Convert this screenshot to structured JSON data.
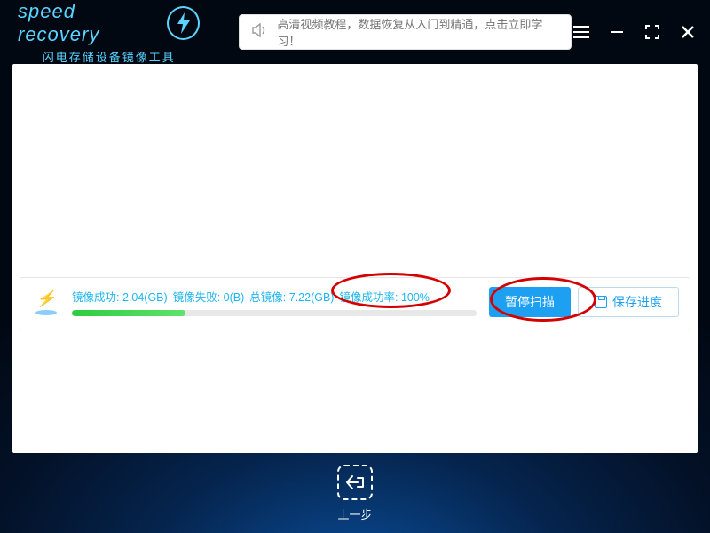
{
  "header": {
    "logo_text": "speed recovery",
    "logo_subtitle": "闪电存储设备镜像工具",
    "promo_text": "高清视频教程，数据恢复从入门到精通，点击立即学习！"
  },
  "progress": {
    "success_label": "镜像成功:",
    "success_value": "2.04(GB)",
    "fail_label": "镜像失败:",
    "fail_value": "0(B)",
    "total_label": "总镜像:",
    "total_value": "7.22(GB)",
    "rate_label": "镜像成功率:",
    "rate_value": "100%",
    "percent_fill": 28
  },
  "buttons": {
    "pause": "暂停扫描",
    "save": "保存进度"
  },
  "footer": {
    "back": "上一步"
  }
}
